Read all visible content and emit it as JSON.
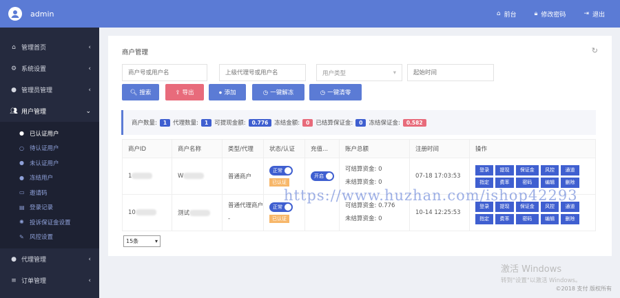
{
  "topbar": {
    "username": "admin",
    "links": [
      {
        "label": "前台",
        "icon": "home-icon"
      },
      {
        "label": "修改密码",
        "icon": "lock-icon"
      },
      {
        "label": "退出",
        "icon": "logout-icon"
      }
    ]
  },
  "sidebar": {
    "menus": [
      {
        "label": "管理首页",
        "icon": "home-icon"
      },
      {
        "label": "系统设置",
        "icon": "gears-icon"
      },
      {
        "label": "管理员管理",
        "icon": "user-circle-icon"
      },
      {
        "label": "用户管理",
        "icon": "users-icon"
      }
    ],
    "submenus": [
      {
        "label": "已认证用户",
        "active": true
      },
      {
        "label": "待认证用户"
      },
      {
        "label": "未认证用户"
      },
      {
        "label": "冻结用户"
      },
      {
        "label": "邀请码"
      },
      {
        "label": "登录记录"
      },
      {
        "label": "投诉保证金设置"
      },
      {
        "label": "风控设置"
      }
    ],
    "bottom_menus": [
      {
        "label": "代理管理",
        "icon": "user-circle-icon"
      },
      {
        "label": "订单管理",
        "icon": "list-icon"
      }
    ]
  },
  "page": {
    "title": "商户管理",
    "filters": {
      "merchant": "商户号或用户名",
      "agent": "上级代理号或用户名",
      "type": "用户类型",
      "start": "起始时间"
    },
    "buttons": {
      "search": "搜索",
      "export": "导出",
      "add": "添加",
      "unfreeze": "一键解冻",
      "clear": "一键清零"
    },
    "stats": {
      "merchant_count_label": "商户数量:",
      "merchant_count": "1",
      "agent_count_label": "代理数量:",
      "agent_count": "1",
      "withdrawable_label": "可提现金额:",
      "withdrawable": "0.776",
      "frozen_label": "冻结金额:",
      "frozen": "0",
      "settled_label": "已结算保证金:",
      "settled": "0",
      "frozen_deposit_label": "冻结保证金:",
      "frozen_deposit": "0.582"
    },
    "table": {
      "headers": [
        "商户ID",
        "商户名称",
        "类型/代理",
        "状态/认证",
        "充值...",
        "账户总额",
        "注册时间",
        "操作"
      ],
      "rows": [
        {
          "id": "1",
          "name": "W",
          "type": "普通商户",
          "agent": "",
          "status": "正常",
          "auth": "已认证",
          "recharge": "开启",
          "avail_label": "可结算资金:",
          "avail": "0",
          "unsettled_label": "未结算资金:",
          "unsettled": "0",
          "time": "07-18 17:03:53"
        },
        {
          "id": "10",
          "name": "测试",
          "type": "普通代理商户",
          "agent": "-",
          "status": "正常",
          "auth": "已认证",
          "recharge": "",
          "avail_label": "可结算资金:",
          "avail": "0.776",
          "unsettled_label": "未结算资金:",
          "unsettled": "0",
          "time": "10-14 12:25:53"
        }
      ],
      "ops": [
        "登录",
        "提现",
        "保证金",
        "风控",
        "通道",
        "指定",
        "费率",
        "密码",
        "编辑",
        "删除"
      ]
    },
    "page_size": "15条"
  },
  "watermark": "https://www.huzhan.com/ishop42293",
  "windows": {
    "line1": "激活 Windows",
    "line2": "转到\"设置\"以激活 Windows。"
  },
  "footer": "©2018 支付 版权所有",
  "colors": {
    "primary": "#5b7bd5",
    "sidebar": "#252a3e",
    "danger": "#e86b7b",
    "teal": "#3aa8a8"
  }
}
